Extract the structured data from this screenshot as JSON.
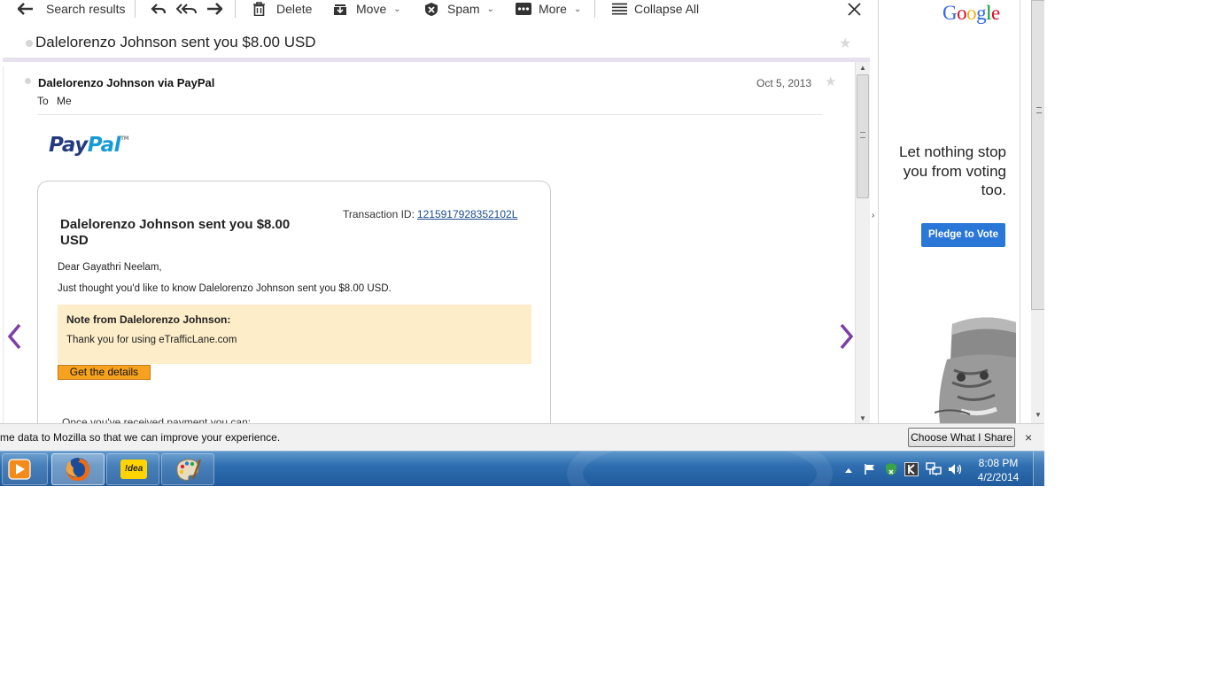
{
  "toolbar": {
    "back_label": "Search results",
    "delete_label": "Delete",
    "move_label": "Move",
    "spam_label": "Spam",
    "more_label": "More",
    "collapse_label": "Collapse All"
  },
  "message": {
    "subject": "Dalelorenzo Johnson sent you $8.00 USD",
    "sender": "Dalelorenzo Johnson via PayPal",
    "date": "Oct 5, 2013",
    "to_label": "To",
    "to_value": "Me"
  },
  "email_body": {
    "logo_pay": "Pay",
    "logo_pal": "Pal",
    "logo_tm": "TM",
    "transaction_label": "Transaction ID:",
    "transaction_id": "1215917928352102L",
    "heading": "Dalelorenzo Johnson sent you $8.00 USD",
    "greeting": "Dear Gayathri Neelam,",
    "notice": "Just thought you'd like to know Dalelorenzo Johnson sent you $8.00 USD.",
    "note_title": "Note from Dalelorenzo Johnson:",
    "note_text": "Thank you for using eTrafficLane.com",
    "details_button": "Get the details",
    "after_text": "Once you've received payment you can:"
  },
  "ad": {
    "brand": [
      "G",
      "o",
      "o",
      "g",
      "l",
      "e"
    ],
    "brand_colors": [
      "#3369e8",
      "#d50f25",
      "#eeb211",
      "#3369e8",
      "#009925",
      "#d50f25"
    ],
    "headline": "Let nothing stop you from voting too.",
    "button": "Pledge to Vote"
  },
  "notification": {
    "text": "me data to Mozilla so that we can improve your experience.",
    "button": "Choose What I Share",
    "close": "×"
  },
  "taskbar": {
    "apps": [
      "media-player",
      "firefox",
      "idea",
      "paint"
    ],
    "idea_label": "!dea",
    "time": "8:08 PM",
    "date": "4/2/2014"
  },
  "colors": {
    "accent_purple": "#7b3fa6",
    "paypal_dark": "#253b80",
    "paypal_light": "#179bd7",
    "note_bg": "#fdedc9",
    "button_orange": "#f7a21e",
    "ad_blue": "#2a77d8"
  }
}
